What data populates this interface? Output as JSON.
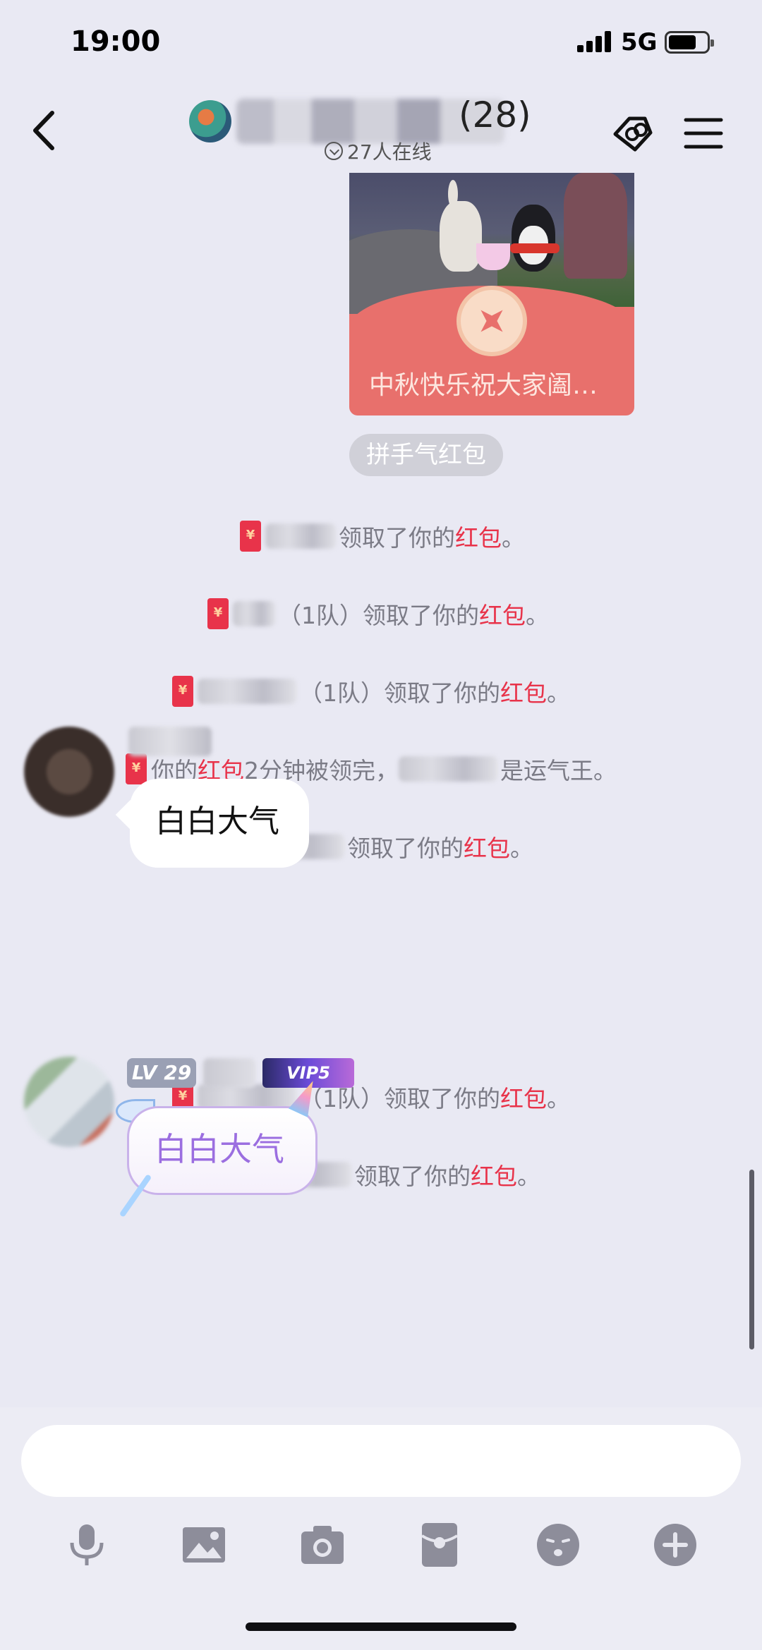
{
  "status": {
    "time": "19:00",
    "network": "5G"
  },
  "header": {
    "member_count": "(28)",
    "online": "27人在线"
  },
  "red_packet": {
    "title": "中秋快乐祝大家阖…"
  },
  "pill": {
    "label": "拼手气红包"
  },
  "system_messages": [
    {
      "pre": "",
      "mid": "领取了你的",
      "hl": "红包",
      "post": "。"
    },
    {
      "pre": "（1队）",
      "mid": "领取了你的",
      "hl": "红包",
      "post": "。"
    },
    {
      "pre": "（1队）",
      "mid": "领取了你的",
      "hl": "红包",
      "post": "。"
    },
    {
      "lead": "你的",
      "hl": "红包",
      "mid": "2分钟被领完，",
      "post": "是运气王。"
    },
    {
      "pre": "",
      "mid": "领取了你的",
      "hl": "红包",
      "post": "。"
    },
    {
      "pre": "（1队）",
      "mid": "领取了你的",
      "hl": "红包",
      "post": "。"
    },
    {
      "pre": "",
      "mid": "领取了你的",
      "hl": "红包",
      "post": "。"
    }
  ],
  "messages": [
    {
      "text": "白白大气"
    },
    {
      "text": "白白大气",
      "level": "LV 29",
      "vip": "VIP5"
    }
  ],
  "input": {
    "placeholder": ""
  },
  "toolbar": [
    "microphone-icon",
    "image-icon",
    "camera-icon",
    "red-packet-icon",
    "emoji-icon",
    "plus-icon"
  ],
  "colors": {
    "accent_red": "#e8334a",
    "background": "#e9e9f3"
  }
}
